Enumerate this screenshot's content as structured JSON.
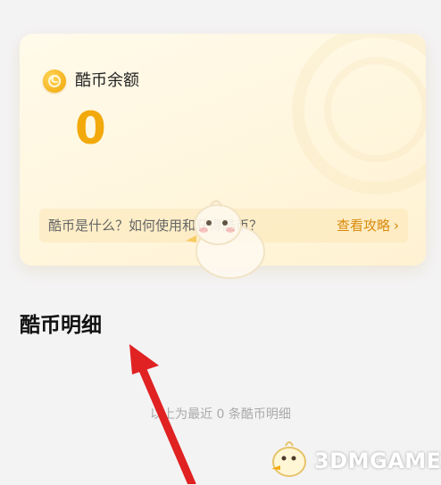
{
  "card": {
    "balance_label": "酷币余额",
    "balance_value": "0",
    "info_question": "酷币是什么？如何使用和获得酷币？",
    "info_link": "查看攻略"
  },
  "section": {
    "title": "酷币明细",
    "empty_note": "以上为最近 0 条酷币明细"
  },
  "watermark": {
    "text": "3DMGAME"
  },
  "colors": {
    "accent": "#f2a90c",
    "link": "#d98a0b",
    "arrow": "#e02222"
  }
}
